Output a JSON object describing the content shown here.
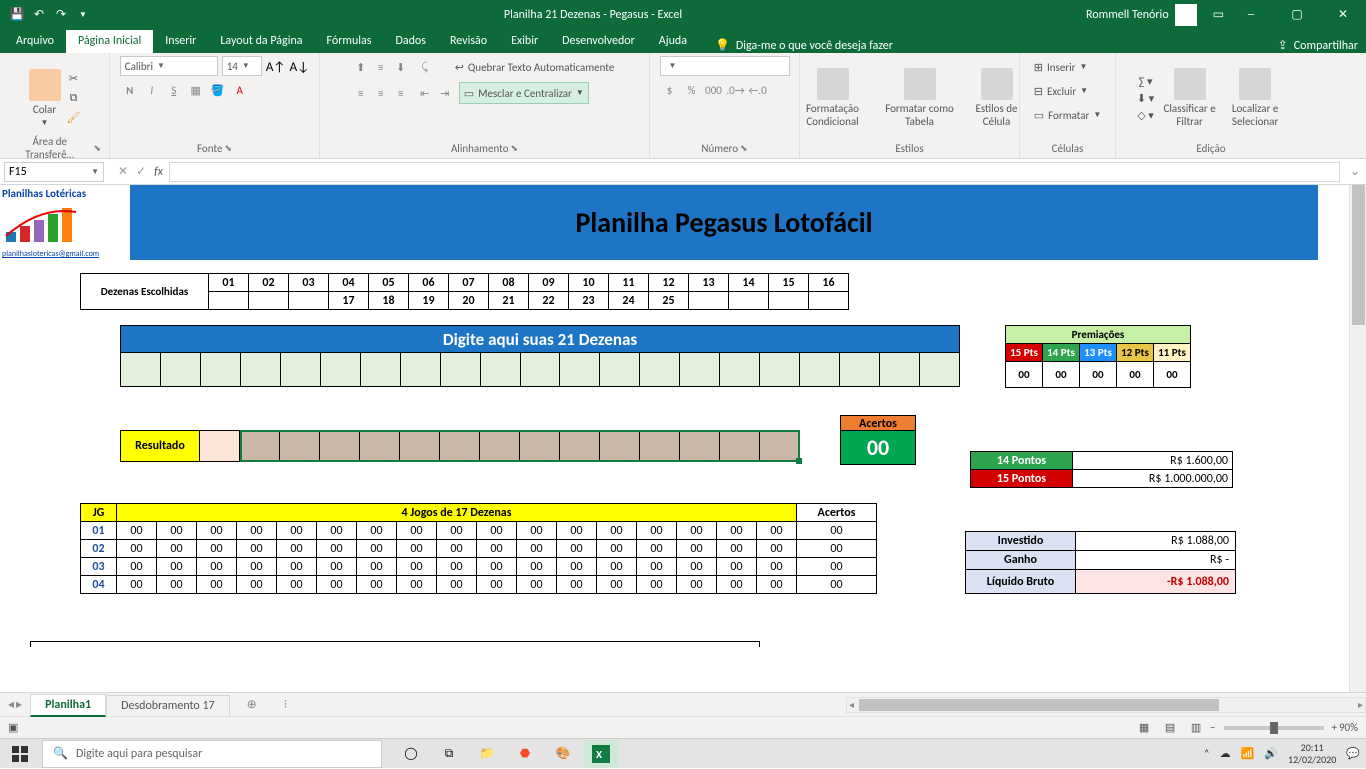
{
  "titlebar": {
    "title": "Planilha 21 Dezenas - Pegasus  -  Excel",
    "user": "Rommell Tenório"
  },
  "tabs": {
    "items": [
      "Arquivo",
      "Página Inicial",
      "Inserir",
      "Layout da Página",
      "Fórmulas",
      "Dados",
      "Revisão",
      "Exibir",
      "Desenvolvedor",
      "Ajuda"
    ],
    "tellme": "Diga-me o que você deseja fazer",
    "share": "Compartilhar"
  },
  "ribbon": {
    "clipboard": {
      "paste": "Colar",
      "label": "Área de Transferê…"
    },
    "font": {
      "name": "Calibri",
      "size": "14",
      "label": "Fonte"
    },
    "alignment": {
      "wrap": "Quebrar Texto Automaticamente",
      "merge": "Mesclar e Centralizar",
      "label": "Alinhamento"
    },
    "number": {
      "label": "Número"
    },
    "styles": {
      "cf": "Formatação Condicional",
      "ft": "Formatar como Tabela",
      "cs": "Estilos de Célula",
      "label": "Estilos"
    },
    "cells": {
      "insert": "Inserir",
      "delete": "Excluir",
      "format": "Formatar",
      "label": "Células"
    },
    "editing": {
      "sort": "Classificar e Filtrar",
      "find": "Localizar e Selecionar",
      "label": "Edição"
    }
  },
  "formulabar": {
    "namebox": "F15"
  },
  "worksheet": {
    "logo": {
      "title": "Planilhas Lotéricas",
      "mail": "planilhaslotericas@gmail.com"
    },
    "banner": "Planilha Pegasus Lotofácil",
    "dezenasLabel": "Dezenas Escolhidas",
    "dezenasRow1": [
      "01",
      "02",
      "03",
      "04",
      "05",
      "06",
      "07",
      "08",
      "09",
      "10",
      "11",
      "12",
      "13",
      "14",
      "15",
      "16"
    ],
    "dezenasRow2": [
      "17",
      "18",
      "19",
      "20",
      "21",
      "22",
      "23",
      "24",
      "25"
    ],
    "digite": "Digite aqui suas 21 Dezenas",
    "premTitle": "Premiações",
    "premCols": [
      "15 Pts",
      "14 Pts",
      "13 Pts",
      "12 Pts",
      "11 Pts"
    ],
    "premVals": [
      "00",
      "00",
      "00",
      "00",
      "00"
    ],
    "resultadoLabel": "Resultado",
    "acertosLabel": "Acertos",
    "acertosVal": "00",
    "p14label": "14 Pontos",
    "p14val": "R$                      1.600,00",
    "p15label": "15 Pontos",
    "p15val": "R$              1.000.000,00",
    "jogos": {
      "jg": "JG",
      "title": "4 Jogos de 17 Dezenas",
      "ac": "Acertos",
      "rows": [
        {
          "n": "01",
          "c": [
            "00",
            "00",
            "00",
            "00",
            "00",
            "00",
            "00",
            "00",
            "00",
            "00",
            "00",
            "00",
            "00",
            "00",
            "00",
            "00",
            "00"
          ],
          "a": "00"
        },
        {
          "n": "02",
          "c": [
            "00",
            "00",
            "00",
            "00",
            "00",
            "00",
            "00",
            "00",
            "00",
            "00",
            "00",
            "00",
            "00",
            "00",
            "00",
            "00",
            "00"
          ],
          "a": "00"
        },
        {
          "n": "03",
          "c": [
            "00",
            "00",
            "00",
            "00",
            "00",
            "00",
            "00",
            "00",
            "00",
            "00",
            "00",
            "00",
            "00",
            "00",
            "00",
            "00",
            "00"
          ],
          "a": "00"
        },
        {
          "n": "04",
          "c": [
            "00",
            "00",
            "00",
            "00",
            "00",
            "00",
            "00",
            "00",
            "00",
            "00",
            "00",
            "00",
            "00",
            "00",
            "00",
            "00",
            "00"
          ],
          "a": "00"
        }
      ]
    },
    "invest": {
      "l1": "Investido",
      "v1": "R$                      1.088,00",
      "l2": "Ganho",
      "v2": "R$                                   -",
      "l3": "Líquido Bruto",
      "v3": "-R$                     1.088,00"
    }
  },
  "sheettabs": {
    "t1": "Planilha1",
    "t2": "Desdobramento 17"
  },
  "statusbar": {
    "zoom": "90%"
  },
  "taskbar": {
    "search": "Digite aqui para pesquisar",
    "time": "20:11",
    "date": "12/02/2020"
  }
}
